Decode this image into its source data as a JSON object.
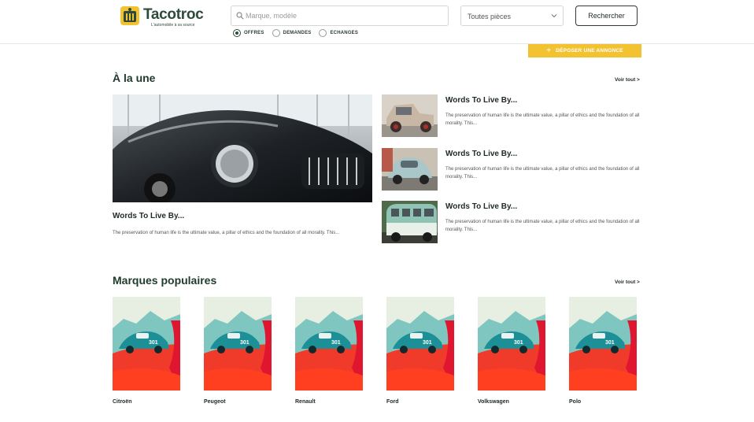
{
  "header": {
    "logo_text": "Tacotroc",
    "logo_tagline": "L'automobile à sa source",
    "search_placeholder": "Marque, modèle",
    "select_value": "Toutes pièces",
    "search_button": "Rechercher",
    "radios": [
      {
        "label": "OFFRES",
        "selected": true
      },
      {
        "label": "DEMANDES",
        "selected": false
      },
      {
        "label": "ECHANGES",
        "selected": false
      }
    ],
    "post_button": "DÉPOSER UNE ANNONCE"
  },
  "featured": {
    "title": "À la une",
    "see_all": "Voir tout >",
    "main": {
      "title": "Words To Live By...",
      "desc": "The preservation of human life is the ultimate value, a pillar of ethics and the foundation of all morality. This..."
    },
    "items": [
      {
        "title": "Words To Live By...",
        "desc": "The preservation of human life is the ultimate value, a pillar of ethics and the foundation of all morality. This..."
      },
      {
        "title": "Words To Live By...",
        "desc": "The preservation of human life is the ultimate value, a pillar of ethics and the foundation of all morality. This..."
      },
      {
        "title": "Words To Live By...",
        "desc": "The preservation of human life is the ultimate value, a pillar of ethics and the foundation of all morality. This..."
      }
    ]
  },
  "brands": {
    "title": "Marques populaires",
    "see_all": "Voir tout >",
    "items": [
      "Citroën",
      "Peugeot",
      "Renault",
      "Ford",
      "Volkswagen",
      "Polo"
    ]
  },
  "colors": {
    "accent": "#f2c230",
    "brand_green": "#2d4a3a"
  }
}
